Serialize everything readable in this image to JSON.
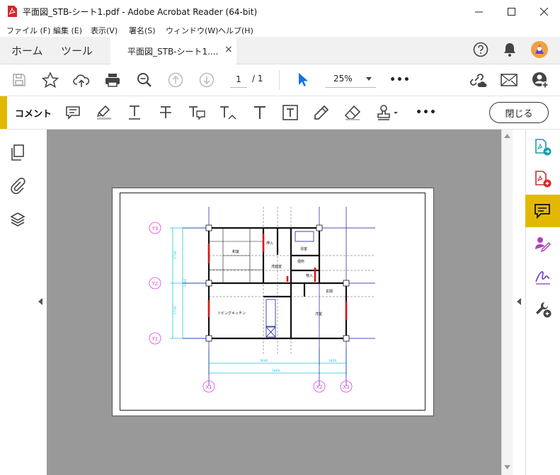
{
  "window": {
    "title": "平面図_STB-シート1.pdf - Adobe Acrobat Reader (64-bit)"
  },
  "menu": [
    "ファイル (F)",
    "編集 (E)",
    "表示(V)",
    "署名(S)",
    "ウィンドウ(W)",
    "ヘルプ(H)"
  ],
  "tabs": {
    "home": "ホーム",
    "tools": "ツール",
    "document": "平面図_STB-シート1....",
    "close_glyph": "×"
  },
  "toolbar": {
    "page_current": "1",
    "page_separator": "/ 1",
    "zoom": "25%",
    "more": "•••"
  },
  "comment_bar": {
    "label": "コメント",
    "close_label": "閉じる",
    "more": "•••"
  },
  "drawing": {
    "grid_y": [
      "Y3",
      "Y2",
      "Y1"
    ],
    "grid_x": [
      "X1",
      "X2",
      "X3"
    ],
    "rooms": {
      "japanese_room": "和室",
      "bath": "浴室",
      "wash": "洗面室",
      "wc": "便所",
      "closet": "押入",
      "storage": "物入",
      "entrance": "玄関",
      "living": "リビングキッチン",
      "western_room": "洋室"
    },
    "dims": {
      "horizontal_sub_left": "3640",
      "horizontal_sub_right": "1820",
      "horizontal_total": "5460",
      "vertical_upper": "2730",
      "vertical_lower": "2730",
      "vertical_total": "5460"
    }
  },
  "colors": {
    "accent_yellow": "#e3b900",
    "doc_background": "#999999",
    "acrobat_red": "#d7262c",
    "select_blue": "#1473e6",
    "drawing_blue": "#1a1aa0",
    "drawing_magenta": "#e040e0",
    "drawing_cyan": "#18c8d8"
  }
}
